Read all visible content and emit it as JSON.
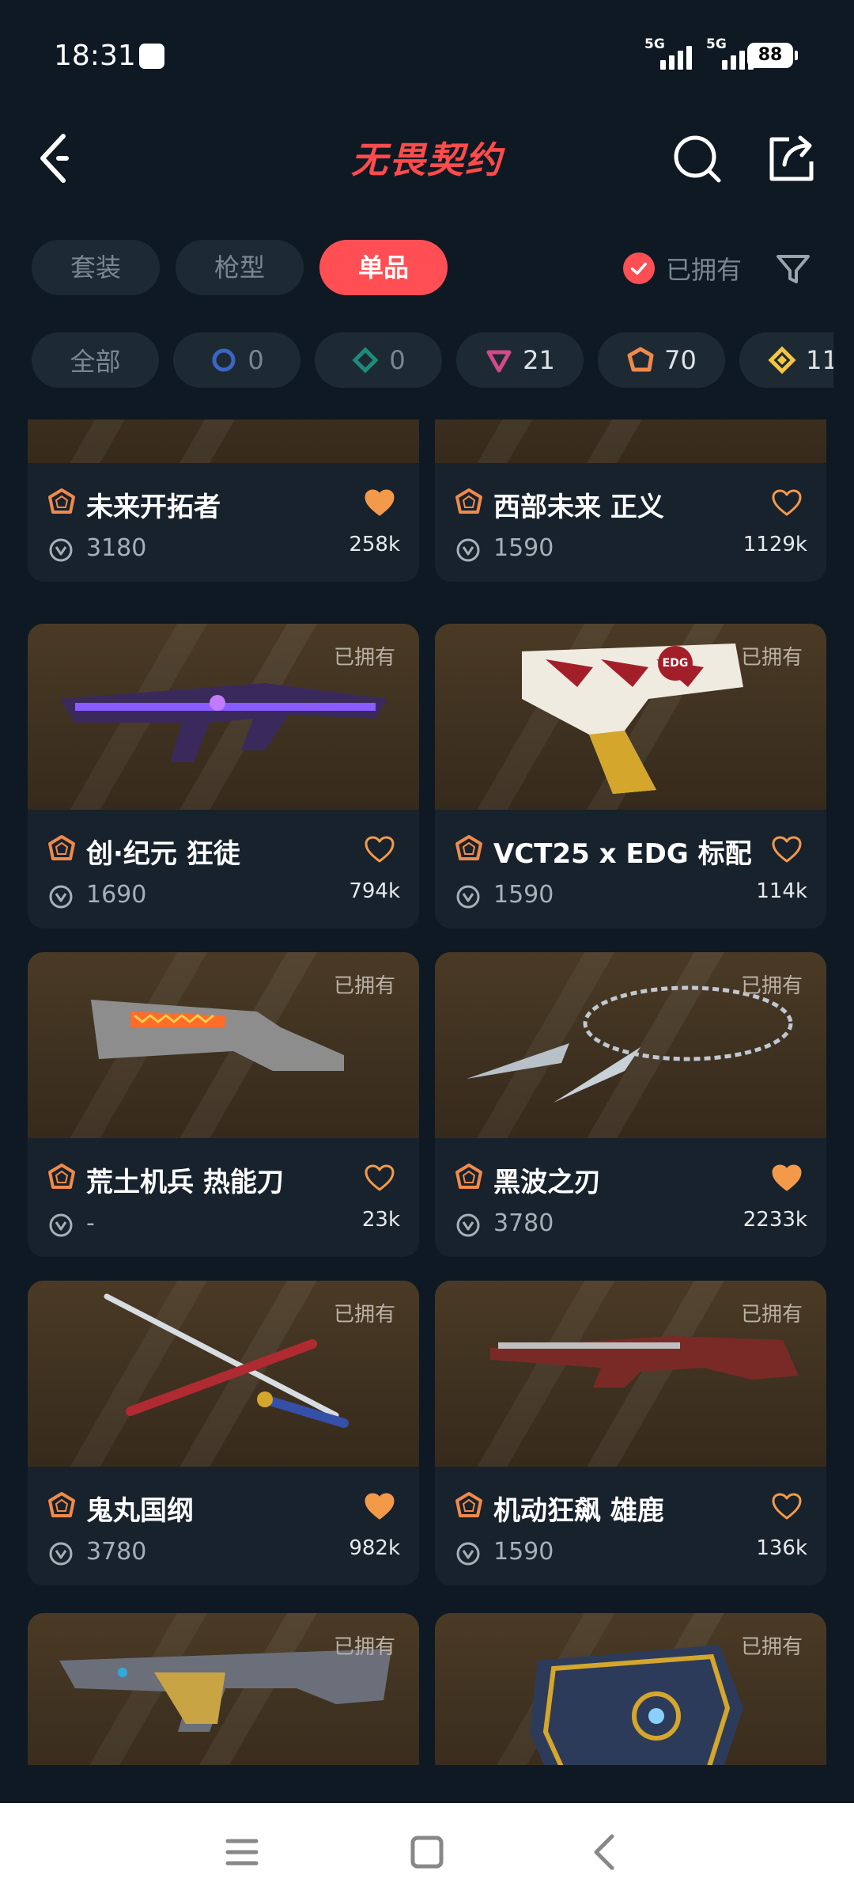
{
  "status": {
    "time": "18:31",
    "signal1": "5G",
    "signal2": "5G",
    "battery": "88"
  },
  "header": {
    "title": "无畏契约"
  },
  "tabs": [
    "套装",
    "枪型",
    "单品"
  ],
  "owned_toggle": "已拥有",
  "chips": [
    {
      "label": "全部"
    },
    {
      "icon": "select-tier-icon",
      "count": "0",
      "color": "#3b66c4"
    },
    {
      "icon": "deluxe-tier-icon",
      "count": "0",
      "color": "#1e8a7a"
    },
    {
      "icon": "premium-tier-icon",
      "count": "21",
      "color": "#d14a8a"
    },
    {
      "icon": "exclusive-tier-icon",
      "count": "70",
      "color": "#f08a4b"
    },
    {
      "icon": "ultra-tier-icon",
      "count": "11",
      "color": "#f4c542"
    }
  ],
  "accent": "#ff4f55",
  "items": [
    {
      "name": "未来开拓者",
      "price": "3180",
      "likes": "258k",
      "liked": true,
      "owned": "",
      "weapon": "axe"
    },
    {
      "name": "西部未来 正义",
      "price": "1590",
      "likes": "1129k",
      "liked": false,
      "owned": "",
      "weapon": "stock"
    },
    {
      "name": "创·纪元 狂徒",
      "price": "1690",
      "likes": "794k",
      "liked": false,
      "owned": "已拥有",
      "weapon": "rifle-purple"
    },
    {
      "name": "VCT25 x EDG 标配",
      "price": "1590",
      "likes": "114k",
      "liked": false,
      "owned": "已拥有",
      "weapon": "pistol",
      "badge": "EDG"
    },
    {
      "name": "荒土机兵 热能刀",
      "price": "-",
      "likes": "23k",
      "liked": false,
      "owned": "已拥有",
      "weapon": "heatknife"
    },
    {
      "name": "黑波之刃",
      "price": "3780",
      "likes": "2233k",
      "liked": true,
      "owned": "已拥有",
      "weapon": "kunai"
    },
    {
      "name": "鬼丸国纲",
      "price": "3780",
      "likes": "982k",
      "liked": true,
      "owned": "已拥有",
      "weapon": "katana"
    },
    {
      "name": "机动狂飙 雄鹿",
      "price": "1590",
      "likes": "136k",
      "liked": false,
      "owned": "已拥有",
      "weapon": "shotgun"
    },
    {
      "name": "",
      "price": "",
      "likes": "",
      "liked": false,
      "owned": "已拥有",
      "weapon": "rifle-gold"
    },
    {
      "name": "",
      "price": "",
      "likes": "",
      "liked": false,
      "owned": "已拥有",
      "weapon": "fist"
    }
  ]
}
